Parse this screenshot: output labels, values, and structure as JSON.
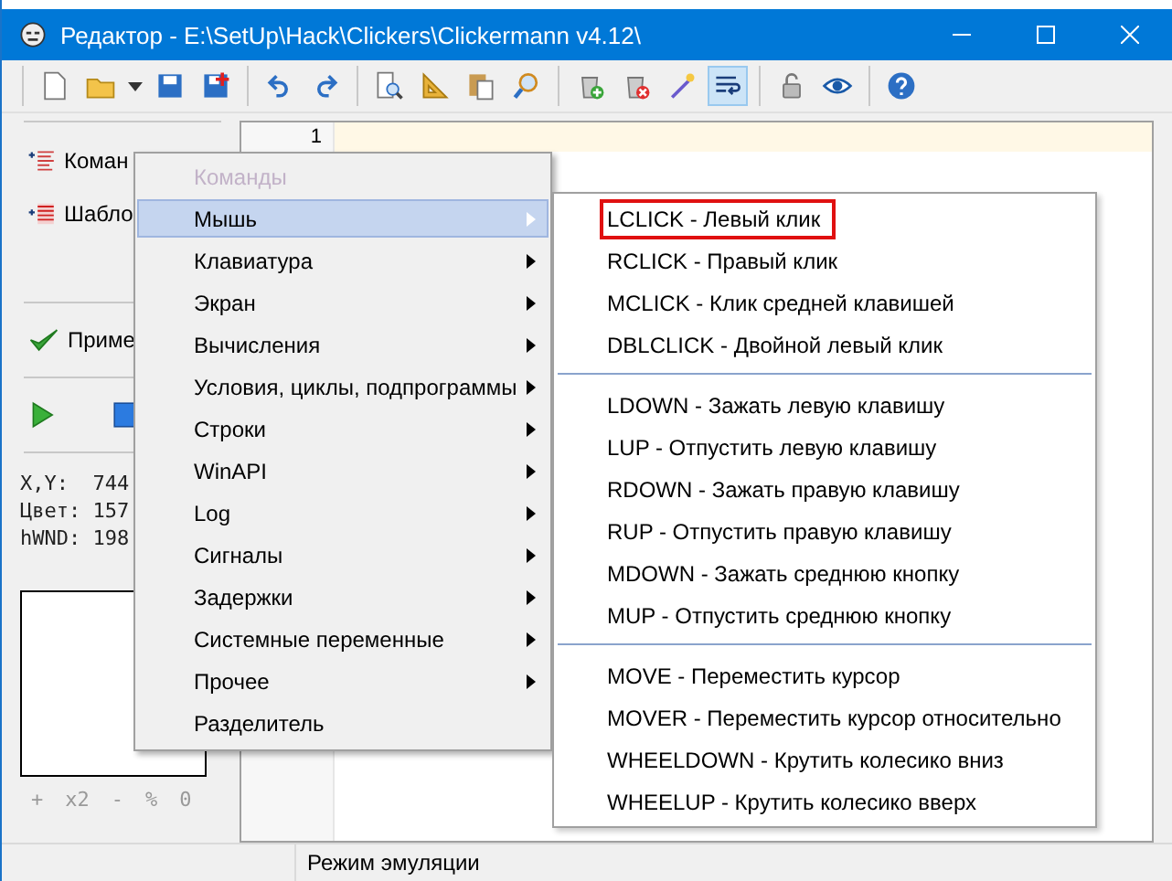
{
  "window": {
    "title": "Редактор - E:\\SetUp\\Hack\\Clickers\\Clickermann v4.12\\"
  },
  "toolbar": [
    {
      "kind": "new",
      "pressed": false
    },
    {
      "kind": "open",
      "pressed": false
    },
    {
      "kind": "dropdown",
      "pressed": false
    },
    {
      "kind": "save",
      "pressed": false
    },
    {
      "kind": "saveas",
      "pressed": false
    },
    {
      "kind": "separator"
    },
    {
      "kind": "undo",
      "pressed": false
    },
    {
      "kind": "redo",
      "pressed": false
    },
    {
      "kind": "separator"
    },
    {
      "kind": "preview",
      "pressed": false
    },
    {
      "kind": "ruler",
      "pressed": false
    },
    {
      "kind": "paste",
      "pressed": false
    },
    {
      "kind": "find",
      "pressed": false
    },
    {
      "kind": "separator"
    },
    {
      "kind": "add",
      "pressed": false
    },
    {
      "kind": "remove",
      "pressed": false
    },
    {
      "kind": "wand",
      "pressed": false
    },
    {
      "kind": "wrap",
      "pressed": true
    },
    {
      "kind": "separator"
    },
    {
      "kind": "lock",
      "pressed": false
    },
    {
      "kind": "eye",
      "pressed": false
    },
    {
      "kind": "separator"
    },
    {
      "kind": "help",
      "pressed": false
    }
  ],
  "sidebar": {
    "items": [
      {
        "kind": "commands",
        "label": "Коман"
      },
      {
        "kind": "templates",
        "label": "Шабло"
      }
    ],
    "apply": "Приме",
    "readouts": [
      "X,Y:  744",
      "Цвет: 157",
      "hWND: 198"
    ],
    "zoom": [
      "+",
      "x2",
      "-",
      "%",
      "0"
    ]
  },
  "editor": {
    "line_numbers": [
      "1"
    ]
  },
  "menu": {
    "items": [
      {
        "label": "Команды",
        "disabled": true,
        "selected": false,
        "submenu": false
      },
      {
        "label": "Мышь",
        "disabled": false,
        "selected": true,
        "submenu": true
      },
      {
        "label": "Клавиатура",
        "disabled": false,
        "selected": false,
        "submenu": true
      },
      {
        "label": "Экран",
        "disabled": false,
        "selected": false,
        "submenu": true
      },
      {
        "label": "Вычисления",
        "disabled": false,
        "selected": false,
        "submenu": true
      },
      {
        "label": "Условия, циклы, подпрограммы",
        "disabled": false,
        "selected": false,
        "submenu": true
      },
      {
        "label": "Строки",
        "disabled": false,
        "selected": false,
        "submenu": true
      },
      {
        "label": "WinAPI",
        "disabled": false,
        "selected": false,
        "submenu": true
      },
      {
        "label": "Log",
        "disabled": false,
        "selected": false,
        "submenu": true
      },
      {
        "label": "Сигналы",
        "disabled": false,
        "selected": false,
        "submenu": true
      },
      {
        "label": "Задержки",
        "disabled": false,
        "selected": false,
        "submenu": true
      },
      {
        "label": "Системные переменные",
        "disabled": false,
        "selected": false,
        "submenu": true
      },
      {
        "label": "Прочее",
        "disabled": false,
        "selected": false,
        "submenu": true
      },
      {
        "label": "Разделитель",
        "disabled": false,
        "selected": false,
        "submenu": false
      }
    ]
  },
  "submenu": {
    "groups": [
      [
        {
          "label": "LCLICK - Левый клик",
          "highlighted": true
        },
        {
          "label": "RCLICK - Правый клик",
          "highlighted": false
        },
        {
          "label": "MCLICK - Клик средней клавишей",
          "highlighted": false
        },
        {
          "label": "DBLCLICK - Двойной левый клик",
          "highlighted": false
        }
      ],
      [
        {
          "label": "LDOWN - Зажать левую клавишу",
          "highlighted": false
        },
        {
          "label": "LUP - Отпустить левую клавишу",
          "highlighted": false
        },
        {
          "label": "RDOWN - Зажать правую клавишу",
          "highlighted": false
        },
        {
          "label": "RUP - Отпустить правую клавишу",
          "highlighted": false
        },
        {
          "label": "MDOWN - Зажать среднюю кнопку",
          "highlighted": false
        },
        {
          "label": "MUP - Отпустить среднюю кнопку",
          "highlighted": false
        }
      ],
      [
        {
          "label": "MOVE - Переместить курсор",
          "highlighted": false
        },
        {
          "label": "MOVER - Переместить курсор относительно",
          "highlighted": false
        },
        {
          "label": "WHEELDOWN - Крутить колесико вниз",
          "highlighted": false
        },
        {
          "label": "WHEELUP - Крутить колесико вверх",
          "highlighted": false
        }
      ]
    ]
  },
  "status_bar": {
    "text": "Режим эмуляции"
  }
}
